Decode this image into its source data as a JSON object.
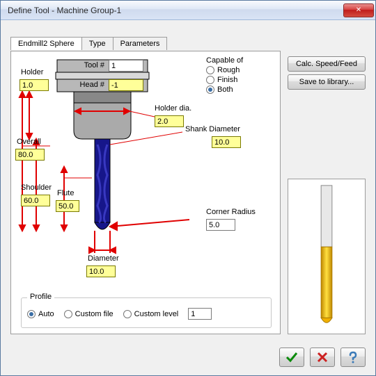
{
  "window": {
    "title": "Define Tool - Machine Group-1"
  },
  "tabs": {
    "t1": "Endmill2 Sphere",
    "t2": "Type",
    "t3": "Parameters"
  },
  "side": {
    "calc": "Calc. Speed/Feed",
    "save": "Save to library..."
  },
  "capable": {
    "header": "Capable of",
    "rough": "Rough",
    "finish": "Finish",
    "both": "Both",
    "selected": "both"
  },
  "fields": {
    "toolnum_label": "Tool #",
    "toolnum_value": "1",
    "headnum_label": "Head #",
    "headnum_value": "-1",
    "holder_label": "Holder",
    "holder_value": "1.0",
    "holderdia_label": "Holder dia.",
    "holderdia_value": "2.0",
    "overall_label": "Overall",
    "overall_value": "80.0",
    "shoulder_label": "Shoulder",
    "shoulder_value": "60.0",
    "flute_label": "Flute",
    "flute_value": "50.0",
    "diameter_label": "Diameter",
    "diameter_value": "10.0",
    "shank_label": "Shank Diameter",
    "shank_value": "10.0",
    "corner_label": "Corner Radius",
    "corner_value": "5.0"
  },
  "profile": {
    "title": "Profile",
    "auto": "Auto",
    "customfile": "Custom file",
    "customlevel": "Custom level",
    "level_value": "1",
    "selected": "auto"
  }
}
